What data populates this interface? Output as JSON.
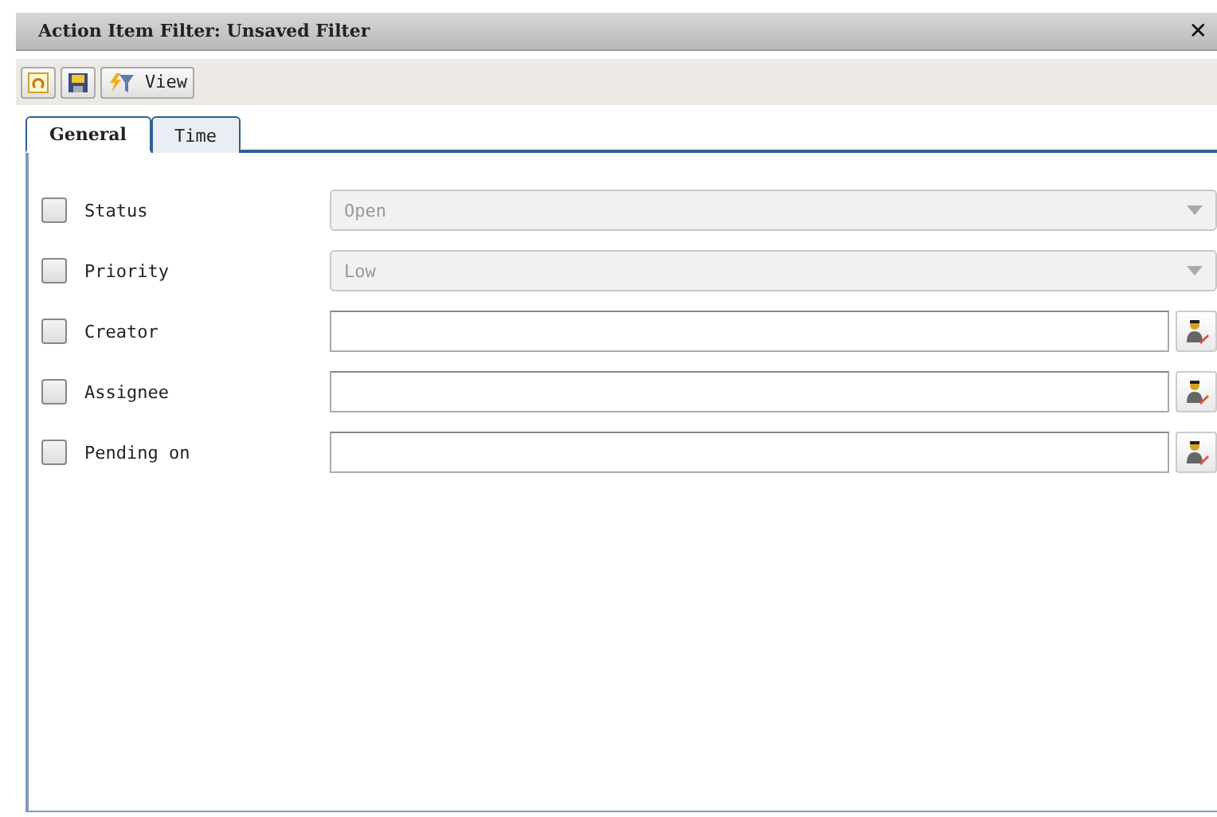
{
  "window": {
    "title": "Action Item Filter: Unsaved Filter",
    "close": "✕"
  },
  "toolbar": {
    "buttons": [
      {
        "kind": "refresh"
      },
      {
        "kind": "save"
      },
      {
        "kind": "view",
        "label": "View"
      }
    ]
  },
  "tabs": [
    {
      "label": "General",
      "selected": true
    },
    {
      "label": "Time",
      "selected": false
    }
  ],
  "fields": [
    {
      "kind": "select",
      "label": "Status",
      "checked": false,
      "value": "Open"
    },
    {
      "kind": "select",
      "label": "Priority",
      "checked": false,
      "value": "Low"
    },
    {
      "kind": "person",
      "label": "Creator",
      "checked": false
    },
    {
      "kind": "person",
      "label": "Assignee",
      "checked": false
    },
    {
      "kind": "person",
      "label": "Pending on",
      "checked": false
    }
  ]
}
